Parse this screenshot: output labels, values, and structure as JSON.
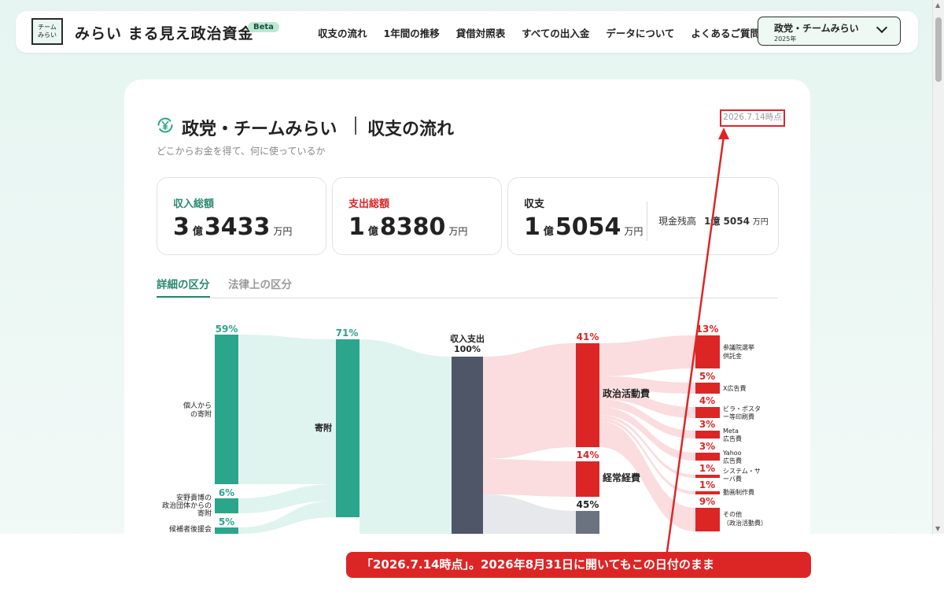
{
  "header": {
    "logo_lines": [
      "チーム",
      "みらい"
    ],
    "site_title": "みらい まる見え政治資金",
    "beta_badge": "Beta",
    "nav": [
      "収支の流れ",
      "1年間の推移",
      "貸借対照表",
      "すべての出入金",
      "データについて",
      "よくあるご質問"
    ],
    "org_selector": {
      "name": "政党・チームみらい",
      "year": "2025年"
    }
  },
  "page": {
    "org_name": "政党・チームみらい",
    "section_title": "収支の流れ",
    "tagline": "どこからお金を得て、何に使っているか",
    "as_of": "2026.7.14時点"
  },
  "stats": {
    "income": {
      "label": "収入総額",
      "oku": "3",
      "oku_unit": "億",
      "man": "3433",
      "man_unit": "万円"
    },
    "expense": {
      "label": "支出総額",
      "oku": "1",
      "oku_unit": "億",
      "man": "8380",
      "man_unit": "万円"
    },
    "balance": {
      "label": "収支",
      "oku": "1",
      "oku_unit": "億",
      "man": "5054",
      "man_unit": "万円"
    },
    "cash_balance": {
      "label": "現金残高",
      "value": "1億 5054",
      "unit": "万円"
    }
  },
  "tabs": [
    {
      "label": "詳細の区分",
      "active": true
    },
    {
      "label": "法律上の区分",
      "active": false
    }
  ],
  "sankey": {
    "colors": {
      "income": "#2ba58c",
      "center": "#4f5668",
      "expense": "#dc2626",
      "balance": "#6b7280",
      "income_flow": "#dff4ee",
      "expense_flow": "#fbdcdf",
      "balance_flow": "#e6e8ec"
    },
    "sources": [
      {
        "label": "個人から\nの寄附",
        "pct": "59%"
      },
      {
        "label": "安野貴博の\n政治団体からの\n寄附",
        "pct": "6%"
      },
      {
        "label": "候補者後援会",
        "pct": "5%"
      }
    ],
    "income_categories": [
      {
        "label": "寄附",
        "pct": "71%"
      }
    ],
    "center": {
      "label": "収入支出",
      "pct": "100%"
    },
    "expense_categories": [
      {
        "label": "政治活動費",
        "pct": "41%"
      },
      {
        "label": "経常経費",
        "pct": "14%"
      },
      {
        "label": "",
        "pct": "45%"
      }
    ],
    "expense_items": [
      {
        "label": "参議院選挙\n供託金",
        "pct": "13%"
      },
      {
        "label": "X広告費",
        "pct": "5%"
      },
      {
        "label": "ビラ・ポスタ\nー等印刷費",
        "pct": "4%"
      },
      {
        "label": "Meta\n広告費",
        "pct": "3%"
      },
      {
        "label": "Yahoo\n広告費",
        "pct": "3%"
      },
      {
        "label": "システム・サ\nーバ費",
        "pct": "1%"
      },
      {
        "label": "動画制作費",
        "pct": "1%"
      },
      {
        "label": "その他\n（政治活動費）",
        "pct": "9%"
      }
    ]
  },
  "annotation": "「2026.7.14時点」。2026年8月31日に開いてもこの日付のまま",
  "scrollbar": {
    "up": "▲",
    "down": "▼"
  }
}
